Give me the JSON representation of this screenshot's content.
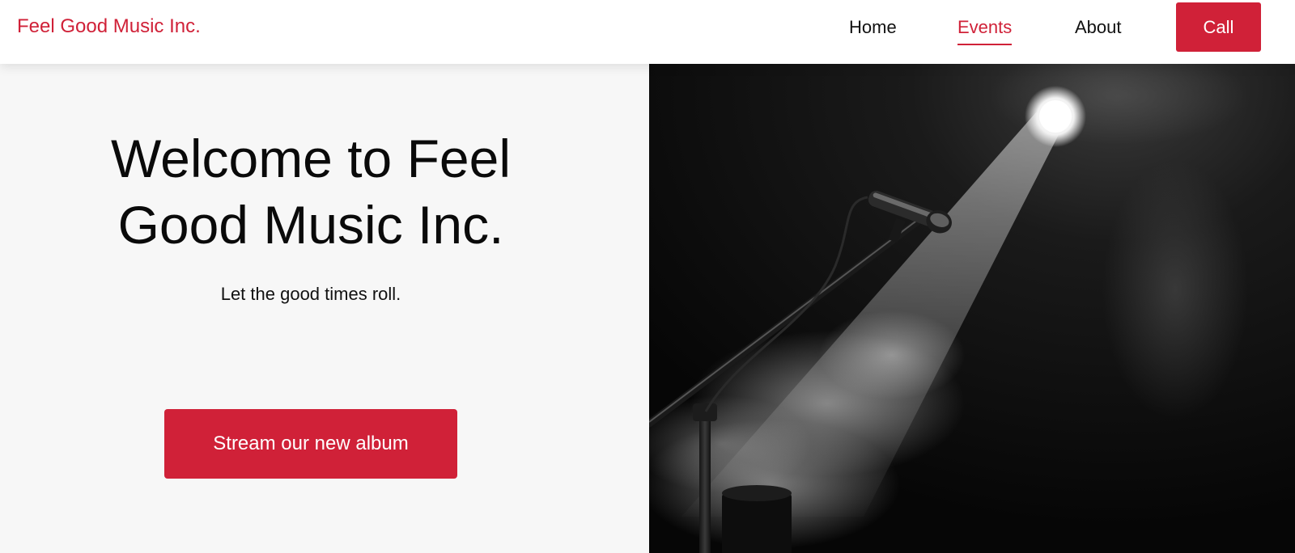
{
  "header": {
    "brand": "Feel Good Music Inc.",
    "nav": [
      {
        "label": "Home",
        "active": false
      },
      {
        "label": "Events",
        "active": true
      },
      {
        "label": "About",
        "active": false
      }
    ],
    "call_label": "Call"
  },
  "hero": {
    "title_line1": "Welcome to Feel",
    "title_line2": "Good Music Inc.",
    "subtitle": "Let the good times roll.",
    "cta_label": "Stream our new album"
  },
  "theme": {
    "accent": "#d02138",
    "left_bg": "#f7f7f7",
    "text": "#0a0a0a"
  },
  "photo": {
    "subject": "microphone-on-stage-spotlight",
    "style": "black-and-white"
  }
}
